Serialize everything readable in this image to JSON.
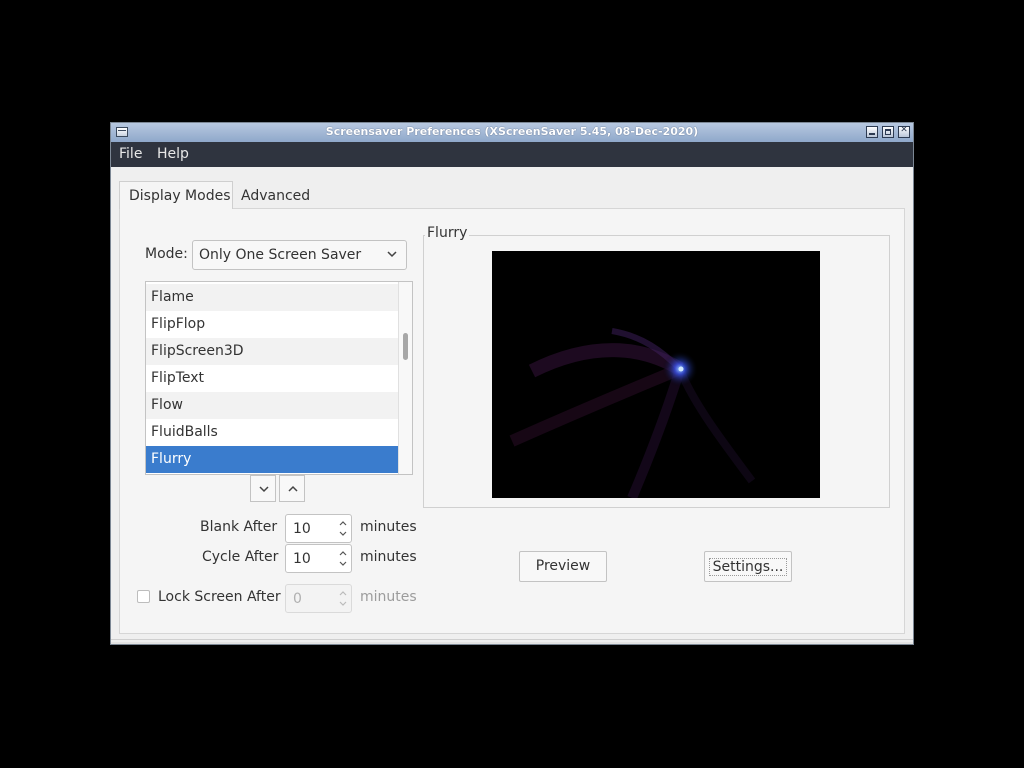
{
  "window": {
    "title": "Screensaver Preferences  (XScreenSaver 5.45, 08-Dec-2020)"
  },
  "menu": [
    "File",
    "Help"
  ],
  "tabs": [
    {
      "label": "Display Modes",
      "active": true
    },
    {
      "label": "Advanced",
      "active": false
    }
  ],
  "mode": {
    "label": "Mode:",
    "value": "Only One Screen Saver",
    "icon": "chevron-down-icon"
  },
  "savers": {
    "items": [
      "Flame",
      "FlipFlop",
      "FlipScreen3D",
      "FlipText",
      "Flow",
      "FluidBalls",
      "Flurry"
    ],
    "selected": "Flurry"
  },
  "timing": {
    "blank_label": "Blank After",
    "blank_value": "10",
    "cycle_label": "Cycle After",
    "cycle_value": "10",
    "lock_label": "Lock Screen After",
    "lock_value": "0",
    "lock_checked": false,
    "units": "minutes"
  },
  "preview": {
    "label": "Flurry"
  },
  "buttons": {
    "preview": "Preview",
    "settings": "Settings..."
  },
  "colors": {
    "selection": "#3a7ccd",
    "menubar": "#2f343f"
  }
}
